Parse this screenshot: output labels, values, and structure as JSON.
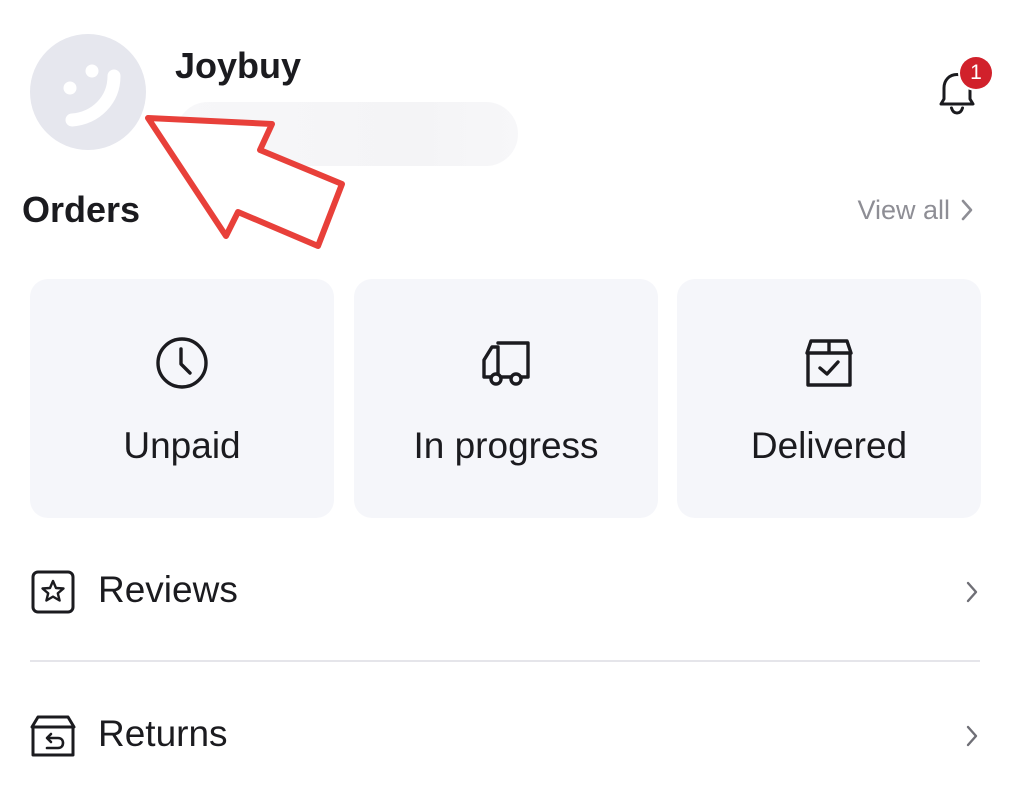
{
  "profile": {
    "username": "Joybuy",
    "avatar_icon": "smiley-avatar-icon"
  },
  "notifications": {
    "icon": "bell-icon",
    "badge_count": "1",
    "badge_color": "#d1212b"
  },
  "annotation": {
    "icon": "red-arrow-pointer",
    "color": "#e8403a"
  },
  "orders": {
    "title": "Orders",
    "view_all_label": "View all",
    "cards": [
      {
        "label": "Unpaid",
        "icon": "clock-icon"
      },
      {
        "label": "In progress",
        "icon": "truck-icon"
      },
      {
        "label": "Delivered",
        "icon": "box-check-icon"
      }
    ]
  },
  "menu": {
    "items": [
      {
        "label": "Reviews",
        "icon": "star-square-icon"
      },
      {
        "label": "Returns",
        "icon": "return-box-icon"
      }
    ]
  },
  "colors": {
    "card_background": "#f5f6fa",
    "muted_text": "#8e8e95",
    "divider": "#e5e5ea"
  }
}
